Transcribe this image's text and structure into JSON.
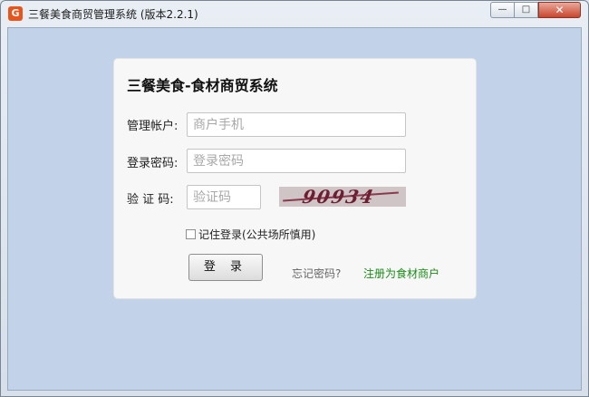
{
  "window": {
    "title": "三餐美食商贸管理系统 (版本2.2.1)",
    "controls": {
      "minimize": "—",
      "maximize": "□",
      "close": "✕"
    }
  },
  "login": {
    "heading": "三餐美食-食材商贸系统",
    "account_label": "管理帐户:",
    "account_placeholder": "商户手机",
    "password_label": "登录密码:",
    "password_placeholder": "登录密码",
    "captcha_label": "验 证 码:",
    "captcha_placeholder": "验证码",
    "captcha_code": "90934",
    "remember_label": "记住登录(公共场所慎用)",
    "remember_checked": false,
    "login_button": "登 录",
    "forgot_link": "忘记密码?",
    "register_link": "注册为食材商户"
  },
  "colors": {
    "client_bg": "#c2d3e9",
    "register_link": "#1a8a18",
    "captcha_text": "#6d1e32"
  }
}
